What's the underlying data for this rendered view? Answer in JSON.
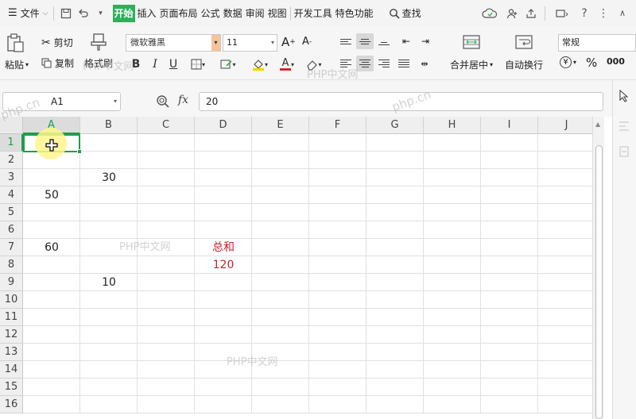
{
  "menubar": {
    "file_label": "文件",
    "tabs": [
      "开始",
      "插入",
      "页面布局",
      "公式",
      "数据",
      "审阅",
      "视图",
      "开发工具",
      "特色功能"
    ],
    "search_label": "查找"
  },
  "ribbon": {
    "paste_label": "粘贴",
    "cut_label": "剪切",
    "copy_label": "复制",
    "format_painter_label": "格式刷",
    "font_name": "微软雅黑",
    "font_size": "11",
    "merge_center_label": "合并居中",
    "wrap_text_label": "自动换行",
    "number_format": "常规"
  },
  "formula_bar": {
    "name_box": "A1",
    "fx_label": "fx",
    "formula": "20"
  },
  "grid": {
    "columns": [
      "A",
      "B",
      "C",
      "D",
      "E",
      "F",
      "G",
      "H",
      "I",
      "J"
    ],
    "rows": [
      "1",
      "2",
      "3",
      "4",
      "5",
      "6",
      "7",
      "8",
      "9",
      "10",
      "11",
      "12",
      "13",
      "14",
      "15",
      "16"
    ],
    "cells": {
      "B3": "30",
      "A4": "50",
      "A7": "60",
      "D7": "总和",
      "D8": "120",
      "B9": "10"
    }
  },
  "watermarks": [
    "php.cn",
    "PHP中文网",
    "PHP中文网",
    "php.cn",
    "PHP中文网",
    "PHP中文网"
  ],
  "colors": {
    "accent_green": "#2eb05a",
    "sum_red": "#c8202b"
  }
}
